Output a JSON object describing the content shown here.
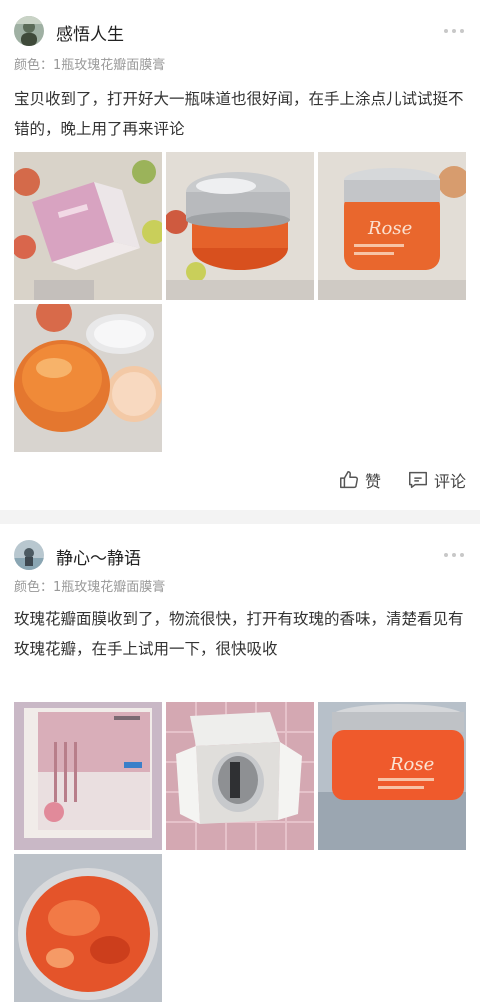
{
  "reviews": [
    {
      "username": "感悟人生",
      "variant": "颜色：1瓶玫瑰花瓣面膜膏",
      "content": "宝贝收到了，打开好大一瓶味道也很好闻，在手上涂点儿试试挺不错的，晚上用了再来评论",
      "photos": [
        "pink-box",
        "jar-silver-lid",
        "jar-rose-label",
        "open-jar-gel"
      ],
      "like_label": "赞",
      "comment_label": "评论"
    },
    {
      "username": "静心～静语",
      "variant": "颜色：1瓶玫瑰花瓣面膜膏",
      "content": "玫瑰花瓣面膜收到了，物流很快，打开有玫瑰的香味，清楚看见有玫瑰花瓣，在手上试用一下，很快吸收",
      "photos": [
        "product-box",
        "open-shipping-box",
        "jar-rose-label",
        "open-jar-gel"
      ]
    }
  ],
  "icons": [
    "more-icon",
    "like-icon",
    "comment-icon"
  ],
  "colors": {
    "divider": "#f3f3f3",
    "secondary_text": "#999999",
    "gel": "#e8672a"
  }
}
